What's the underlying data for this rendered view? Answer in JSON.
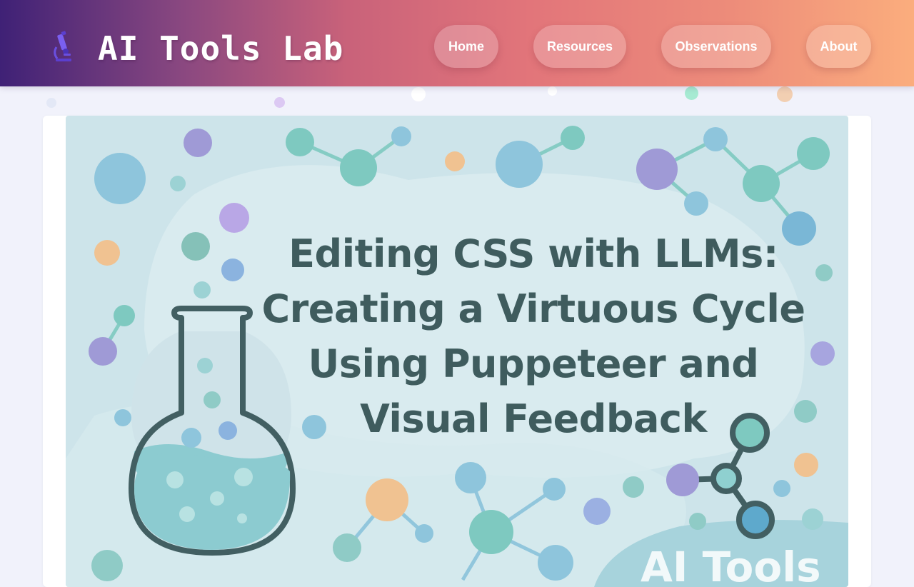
{
  "site": {
    "title": "AI Tools Lab",
    "logo_icon": "microscope-icon"
  },
  "nav": {
    "items": [
      {
        "label": "Home"
      },
      {
        "label": "Resources"
      },
      {
        "label": "Observations"
      },
      {
        "label": "About"
      }
    ]
  },
  "hero": {
    "title_lines": [
      "Editing CSS with LLMs:",
      "Creating a Virtuous Cycle",
      "Using Puppeteer and",
      "Visual Feedback"
    ],
    "watermark": "AI Tools",
    "illustration": "flask-and-molecules"
  },
  "colors": {
    "header_gradient_start": "#3f2176",
    "header_gradient_end": "#fbad7d",
    "page_background": "#f1f2fb",
    "hero_background": "#cde4ea",
    "title_text": "#3f5c5e",
    "bubble_teal": "#7ec9c0",
    "bubble_blue": "#8ec5dc",
    "bubble_purple": "#9f9ad6",
    "bubble_orange": "#f0c291"
  }
}
